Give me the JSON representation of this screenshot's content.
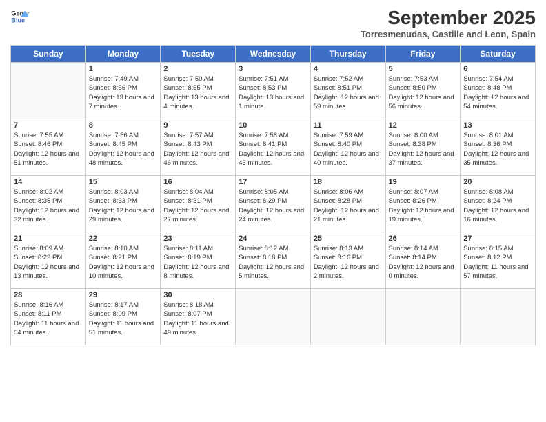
{
  "logo": {
    "line1": "General",
    "line2": "Blue"
  },
  "title": "September 2025",
  "subtitle": "Torresmenudas, Castille and Leon, Spain",
  "weekdays": [
    "Sunday",
    "Monday",
    "Tuesday",
    "Wednesday",
    "Thursday",
    "Friday",
    "Saturday"
  ],
  "weeks": [
    [
      {
        "day": "",
        "sunrise": "",
        "sunset": "",
        "daylight": "",
        "empty": true
      },
      {
        "day": "1",
        "sunrise": "Sunrise: 7:49 AM",
        "sunset": "Sunset: 8:56 PM",
        "daylight": "Daylight: 13 hours and 7 minutes."
      },
      {
        "day": "2",
        "sunrise": "Sunrise: 7:50 AM",
        "sunset": "Sunset: 8:55 PM",
        "daylight": "Daylight: 13 hours and 4 minutes."
      },
      {
        "day": "3",
        "sunrise": "Sunrise: 7:51 AM",
        "sunset": "Sunset: 8:53 PM",
        "daylight": "Daylight: 13 hours and 1 minute."
      },
      {
        "day": "4",
        "sunrise": "Sunrise: 7:52 AM",
        "sunset": "Sunset: 8:51 PM",
        "daylight": "Daylight: 12 hours and 59 minutes."
      },
      {
        "day": "5",
        "sunrise": "Sunrise: 7:53 AM",
        "sunset": "Sunset: 8:50 PM",
        "daylight": "Daylight: 12 hours and 56 minutes."
      },
      {
        "day": "6",
        "sunrise": "Sunrise: 7:54 AM",
        "sunset": "Sunset: 8:48 PM",
        "daylight": "Daylight: 12 hours and 54 minutes."
      }
    ],
    [
      {
        "day": "7",
        "sunrise": "Sunrise: 7:55 AM",
        "sunset": "Sunset: 8:46 PM",
        "daylight": "Daylight: 12 hours and 51 minutes."
      },
      {
        "day": "8",
        "sunrise": "Sunrise: 7:56 AM",
        "sunset": "Sunset: 8:45 PM",
        "daylight": "Daylight: 12 hours and 48 minutes."
      },
      {
        "day": "9",
        "sunrise": "Sunrise: 7:57 AM",
        "sunset": "Sunset: 8:43 PM",
        "daylight": "Daylight: 12 hours and 46 minutes."
      },
      {
        "day": "10",
        "sunrise": "Sunrise: 7:58 AM",
        "sunset": "Sunset: 8:41 PM",
        "daylight": "Daylight: 12 hours and 43 minutes."
      },
      {
        "day": "11",
        "sunrise": "Sunrise: 7:59 AM",
        "sunset": "Sunset: 8:40 PM",
        "daylight": "Daylight: 12 hours and 40 minutes."
      },
      {
        "day": "12",
        "sunrise": "Sunrise: 8:00 AM",
        "sunset": "Sunset: 8:38 PM",
        "daylight": "Daylight: 12 hours and 37 minutes."
      },
      {
        "day": "13",
        "sunrise": "Sunrise: 8:01 AM",
        "sunset": "Sunset: 8:36 PM",
        "daylight": "Daylight: 12 hours and 35 minutes."
      }
    ],
    [
      {
        "day": "14",
        "sunrise": "Sunrise: 8:02 AM",
        "sunset": "Sunset: 8:35 PM",
        "daylight": "Daylight: 12 hours and 32 minutes."
      },
      {
        "day": "15",
        "sunrise": "Sunrise: 8:03 AM",
        "sunset": "Sunset: 8:33 PM",
        "daylight": "Daylight: 12 hours and 29 minutes."
      },
      {
        "day": "16",
        "sunrise": "Sunrise: 8:04 AM",
        "sunset": "Sunset: 8:31 PM",
        "daylight": "Daylight: 12 hours and 27 minutes."
      },
      {
        "day": "17",
        "sunrise": "Sunrise: 8:05 AM",
        "sunset": "Sunset: 8:29 PM",
        "daylight": "Daylight: 12 hours and 24 minutes."
      },
      {
        "day": "18",
        "sunrise": "Sunrise: 8:06 AM",
        "sunset": "Sunset: 8:28 PM",
        "daylight": "Daylight: 12 hours and 21 minutes."
      },
      {
        "day": "19",
        "sunrise": "Sunrise: 8:07 AM",
        "sunset": "Sunset: 8:26 PM",
        "daylight": "Daylight: 12 hours and 19 minutes."
      },
      {
        "day": "20",
        "sunrise": "Sunrise: 8:08 AM",
        "sunset": "Sunset: 8:24 PM",
        "daylight": "Daylight: 12 hours and 16 minutes."
      }
    ],
    [
      {
        "day": "21",
        "sunrise": "Sunrise: 8:09 AM",
        "sunset": "Sunset: 8:23 PM",
        "daylight": "Daylight: 12 hours and 13 minutes."
      },
      {
        "day": "22",
        "sunrise": "Sunrise: 8:10 AM",
        "sunset": "Sunset: 8:21 PM",
        "daylight": "Daylight: 12 hours and 10 minutes."
      },
      {
        "day": "23",
        "sunrise": "Sunrise: 8:11 AM",
        "sunset": "Sunset: 8:19 PM",
        "daylight": "Daylight: 12 hours and 8 minutes."
      },
      {
        "day": "24",
        "sunrise": "Sunrise: 8:12 AM",
        "sunset": "Sunset: 8:18 PM",
        "daylight": "Daylight: 12 hours and 5 minutes."
      },
      {
        "day": "25",
        "sunrise": "Sunrise: 8:13 AM",
        "sunset": "Sunset: 8:16 PM",
        "daylight": "Daylight: 12 hours and 2 minutes."
      },
      {
        "day": "26",
        "sunrise": "Sunrise: 8:14 AM",
        "sunset": "Sunset: 8:14 PM",
        "daylight": "Daylight: 12 hours and 0 minutes."
      },
      {
        "day": "27",
        "sunrise": "Sunrise: 8:15 AM",
        "sunset": "Sunset: 8:12 PM",
        "daylight": "Daylight: 11 hours and 57 minutes."
      }
    ],
    [
      {
        "day": "28",
        "sunrise": "Sunrise: 8:16 AM",
        "sunset": "Sunset: 8:11 PM",
        "daylight": "Daylight: 11 hours and 54 minutes."
      },
      {
        "day": "29",
        "sunrise": "Sunrise: 8:17 AM",
        "sunset": "Sunset: 8:09 PM",
        "daylight": "Daylight: 11 hours and 51 minutes."
      },
      {
        "day": "30",
        "sunrise": "Sunrise: 8:18 AM",
        "sunset": "Sunset: 8:07 PM",
        "daylight": "Daylight: 11 hours and 49 minutes."
      },
      {
        "day": "",
        "sunrise": "",
        "sunset": "",
        "daylight": "",
        "empty": true
      },
      {
        "day": "",
        "sunrise": "",
        "sunset": "",
        "daylight": "",
        "empty": true
      },
      {
        "day": "",
        "sunrise": "",
        "sunset": "",
        "daylight": "",
        "empty": true
      },
      {
        "day": "",
        "sunrise": "",
        "sunset": "",
        "daylight": "",
        "empty": true
      }
    ]
  ]
}
